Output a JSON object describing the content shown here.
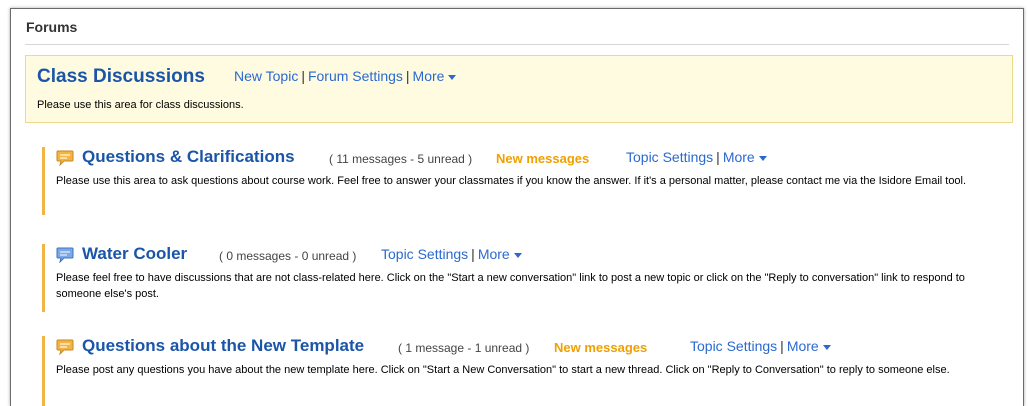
{
  "page": {
    "title": "Forums"
  },
  "forum": {
    "title": "Class Discussions",
    "links": {
      "new_topic": "New Topic",
      "forum_settings": "Forum Settings",
      "more": "More",
      "separator": "|"
    },
    "description": "Please use this area for class discussions."
  },
  "topics": [
    {
      "title": "Questions & Clarifications",
      "counts": "( 11 messages - 5 unread )",
      "new_messages": "New messages",
      "topic_settings": "Topic Settings",
      "more": "More",
      "description": "Please use this area to ask questions about course work. Feel free to answer your classmates if you know the answer. If it's a personal matter, please contact me via the Isidore Email tool.",
      "icon": "chat-bubble-icon",
      "icon_color": "#f3b445"
    },
    {
      "title": "Water Cooler",
      "counts": "( 0 messages - 0 unread )",
      "topic_settings": "Topic Settings",
      "more": "More",
      "description": "Please feel free to have discussions that are not class-related here. Click on the \"Start a new conversation\" link to post a new topic or click on the \"Reply to conversation\" link to respond to someone else's post.",
      "icon": "chat-bubble-icon",
      "icon_color": "#7aa9e6"
    },
    {
      "title": "Questions about the New Template",
      "counts": "( 1 message - 1 unread )",
      "new_messages": "New messages",
      "topic_settings": "Topic Settings",
      "more": "More",
      "description": "Please post any questions you have about the new template here. Click on \"Start a New Conversation\" to start a new thread. Click on \"Reply to Conversation\" to reply to someone else.",
      "icon": "chat-bubble-icon",
      "icon_color": "#f3b445"
    }
  ],
  "colors": {
    "link": "#2a6ad0",
    "title": "#1a55a8",
    "new_messages": "#f0a000",
    "forum_bg": "#fffbe0",
    "accent": "#f3b445"
  }
}
